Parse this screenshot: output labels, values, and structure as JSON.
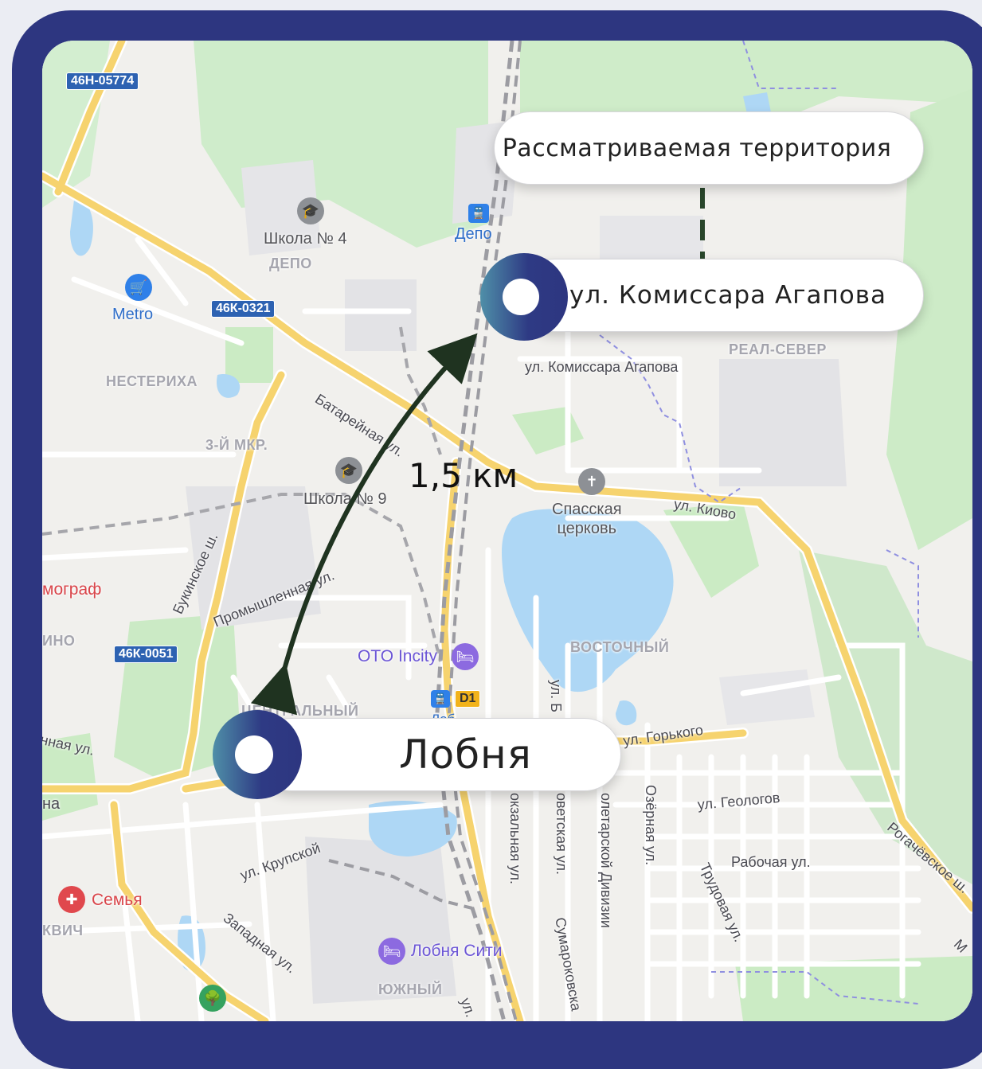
{
  "callouts": {
    "territory": "Рассматриваемая  территория",
    "street": "ул. Комиссара Агапова",
    "city": "Лобня"
  },
  "distance": "1,5 км",
  "shields": [
    "46Н-05774",
    "46К-0321",
    "46К-0051",
    "D1"
  ],
  "districts": [
    "ДЕПО",
    "НЕСТЕРИХА",
    "3-Й МКР.",
    "РЕАЛ-СЕВЕР",
    "ВОСТОЧНЫЙ",
    "ЦЕНТРАЛЬНЫЙ",
    "ЮЖНЫЙ"
  ],
  "streets": {
    "batareynaya": "Батарейная ул.",
    "komissara": "ул. Комиссара Агапова",
    "kiovo": "ул. Киово",
    "bukinskoe": "Букинское ш.",
    "promyshlennaya": "Промышленная ул.",
    "gorkogo": "ул. Горького",
    "geologov": "ул. Геологов",
    "rabochaya": "Рабочая ул.",
    "trudovaya": "Трудовая ул.",
    "krupskoy": "ул. Крупской",
    "zapadnaya": "Западная ул.",
    "ozernaya": "Озёрная ул.",
    "vokzalnaya": "окзальная ул.",
    "sovetskaya": "оветская ул.",
    "proletarskoy": "олетарской Дивизии",
    "sumarokovskaya": "Сумароковска",
    "rogachevskoe": "Рогачёвское ш.",
    "nnaya": "нная ул.",
    "ul_b": "ул. Б",
    "ul_a": "ул. А",
    "m": "М"
  },
  "pois": {
    "school4": "Школа № 4",
    "school9": "Школа № 9",
    "depo": "Депо",
    "metro": "Metro",
    "church": "Спасская церковь",
    "church_l1": "Спасская",
    "church_l2": "церковь",
    "oto": "OTO Incity",
    "lobnya_city": "Лобня Сити",
    "semya": "Семья",
    "mograf": "мограф",
    "ino": "ИНО",
    "kvich": "КВИЧ",
    "na": "на",
    "lob_station": "Лоб"
  },
  "colors": {
    "frame": "#2d3680",
    "park": "#cbebc4",
    "water": "#a9d4f4",
    "highway": "#f6d36e",
    "arrow": "#1f3320"
  },
  "icons": [
    "school-icon",
    "train-icon",
    "metro-store-icon",
    "church-icon",
    "hotel-icon",
    "pharmacy-icon",
    "park-icon"
  ]
}
